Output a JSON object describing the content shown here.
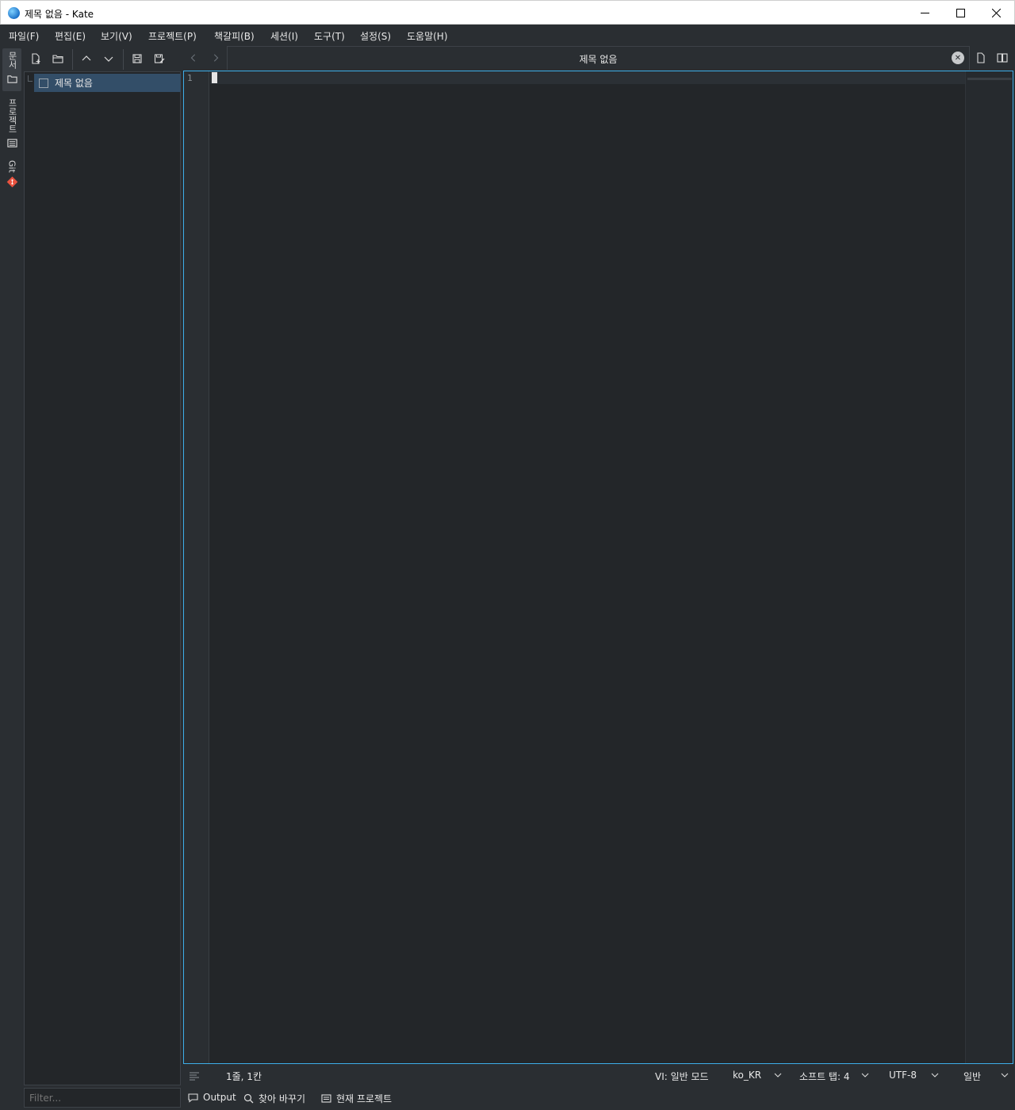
{
  "window": {
    "title": "제목 없음  - Kate",
    "minimize_icon": "minimize-icon",
    "maximize_icon": "maximize-icon",
    "close_icon": "close-icon"
  },
  "menubar": {
    "items": [
      "파일(F)",
      "편집(E)",
      "보기(V)",
      "프로젝트(P)",
      "책갈피(B)",
      "세션(I)",
      "도구(T)",
      "설정(S)",
      "도움말(H)"
    ]
  },
  "sidebar": {
    "tabs": [
      {
        "label": "문서",
        "icon": "folder-icon"
      },
      {
        "label": "프로젝트",
        "icon": "project-list-icon"
      },
      {
        "label": "Git",
        "icon": "git-icon"
      }
    ]
  },
  "documents": {
    "items": [
      "제목 없음"
    ],
    "filter_placeholder": "Filter..."
  },
  "editor": {
    "tab_title": "제목 없음",
    "line_numbers": [
      "1"
    ]
  },
  "statusbar": {
    "position": "1줄, 1칸",
    "vi_mode": "VI: 일반 모드",
    "language": "ko_KR",
    "indent": "소프트 탭: 4",
    "encoding": "UTF-8",
    "mode": "일반"
  },
  "bottom_tools": {
    "output": "Output",
    "search_replace": "찾아 바꾸기",
    "current_project": "현재 프로젝트"
  },
  "colors": {
    "accent": "#3daee9",
    "background": "#2a2e32",
    "editor_bg": "#232629",
    "selection": "#334e68",
    "git": "#e8523f"
  }
}
